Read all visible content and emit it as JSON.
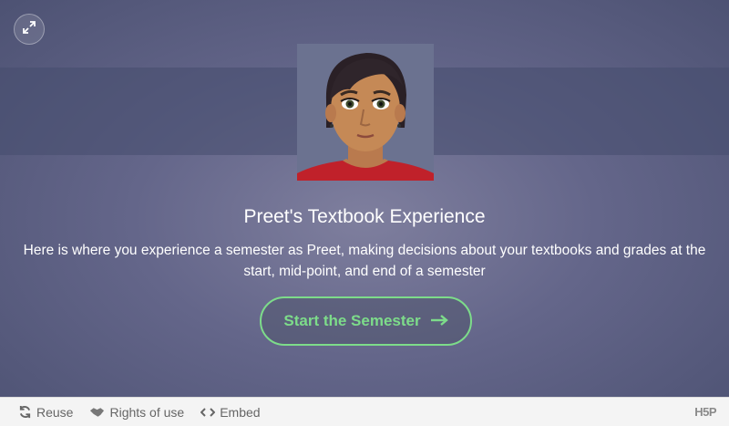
{
  "intro": {
    "title": "Preet's Textbook Experience",
    "description": "Here is where you experience a semester as Preet, making decisions about your textbooks and grades at the start, mid-point, and end of a semester",
    "start_label": "Start the Semester",
    "accent_color": "#7ddc8a"
  },
  "icons": {
    "fullscreen": "expand-icon",
    "start": "arrow-right-icon",
    "reuse": "reuse-icon",
    "rights": "handshake-icon",
    "embed": "code-icon"
  },
  "footer": {
    "reuse_label": "Reuse",
    "rights_label": "Rights of use",
    "embed_label": "Embed",
    "logo": "H5P"
  }
}
